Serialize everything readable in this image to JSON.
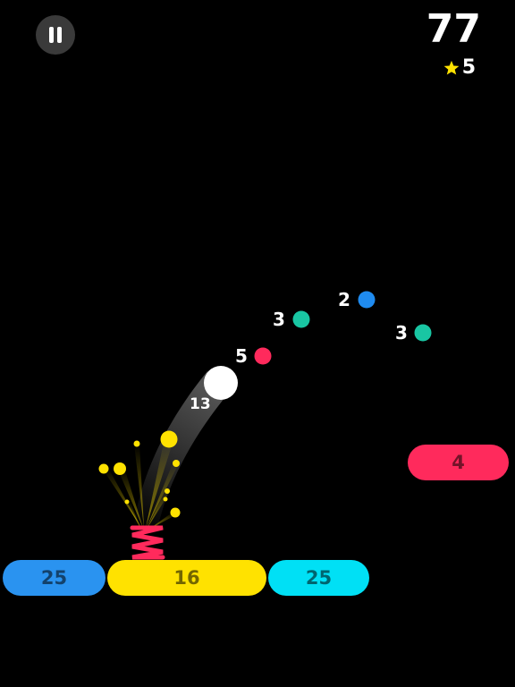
{
  "hud": {
    "score": "77",
    "stars": "5"
  },
  "colors": {
    "blue": "#2a93f0",
    "yellow": "#ffe200",
    "cyan": "#00e0f5",
    "red": "#ff2a5c",
    "teal": "#19c6a3",
    "dotBlue": "#1f8bf0",
    "spring": "#ff2a5c",
    "spark": "#ffe200",
    "pauseBg": "#3a3a3a"
  },
  "ball": {
    "value": "13"
  },
  "dots": [
    {
      "label": "2",
      "color": "dotBlue"
    },
    {
      "label": "3",
      "color": "teal"
    },
    {
      "label": "3",
      "color": "teal"
    },
    {
      "label": "5",
      "color": "red"
    }
  ],
  "platforms": [
    {
      "label": "25",
      "color": "blue"
    },
    {
      "label": "16",
      "color": "yellow"
    },
    {
      "label": "25",
      "color": "cyan"
    },
    {
      "label": "4",
      "color": "red"
    }
  ],
  "icons": {
    "pause": "pause-icon",
    "star": "star-icon"
  }
}
